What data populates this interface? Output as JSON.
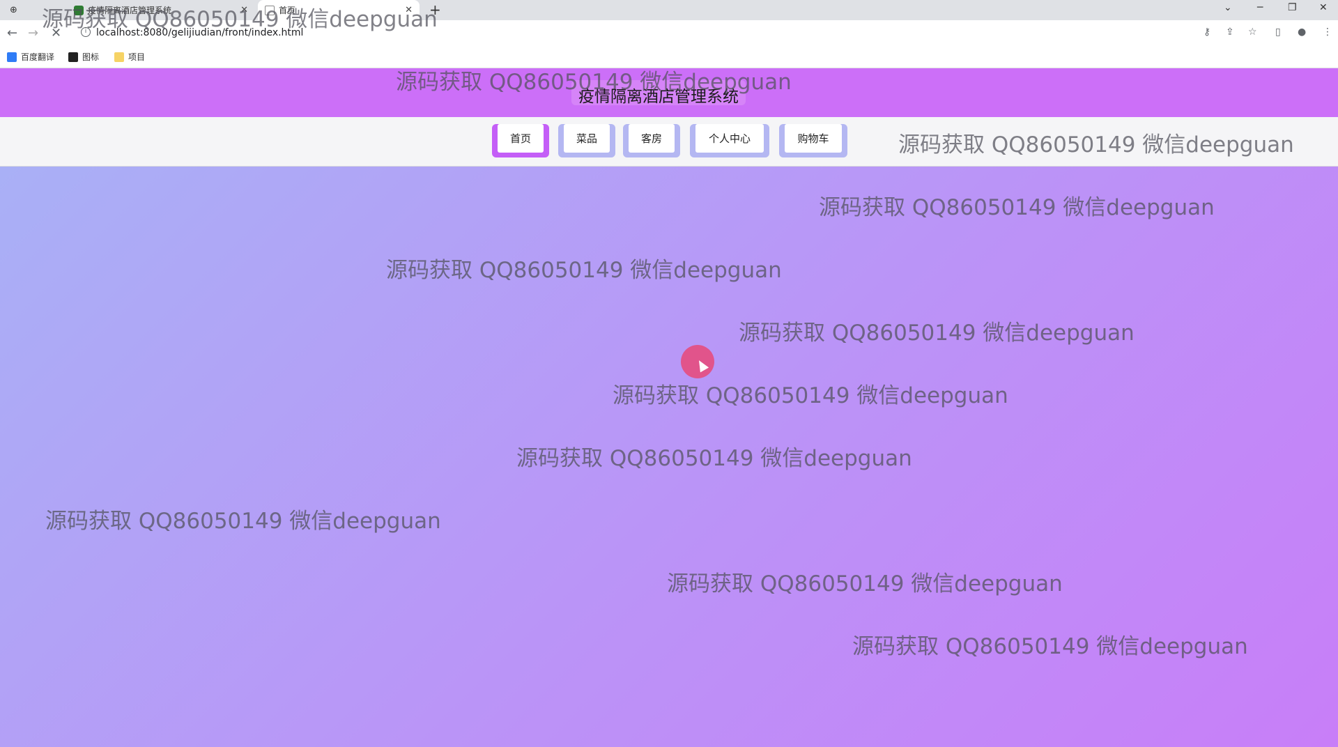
{
  "browser": {
    "tabs": [
      {
        "title": "疫情隔离酒店管理系统",
        "active": false
      },
      {
        "title": "首页",
        "active": true
      }
    ],
    "new_tab": "+",
    "window_controls": {
      "minimize": "─",
      "restore": "❐",
      "close": "✕"
    },
    "url": "localhost:8080/gelijiudian/front/index.html",
    "bookmarks": [
      "百度翻译",
      "图标",
      "项目"
    ]
  },
  "site": {
    "title": "疫情隔离酒店管理系统",
    "nav": [
      {
        "label": "首页",
        "active": true
      },
      {
        "label": "菜品",
        "active": false
      },
      {
        "label": "客房",
        "active": false
      },
      {
        "label": "个人中心",
        "active": false
      },
      {
        "label": "购物车",
        "active": false
      }
    ]
  },
  "watermark": "源码获取 QQ86050149 微信deepguan",
  "colors": {
    "header": "#cc6ff8",
    "nav_active": "#c45ef7",
    "nav_inactive": "#b4b7f2",
    "background_start": "#a9b0f6",
    "background_end": "#c87ef8",
    "cursor_highlight": "#e84878"
  },
  "icons": [
    "back-icon",
    "forward-icon",
    "stop-icon",
    "info-icon",
    "key-icon",
    "share-icon",
    "star-icon",
    "sidepanel-icon",
    "profile-icon",
    "menu-icon"
  ]
}
